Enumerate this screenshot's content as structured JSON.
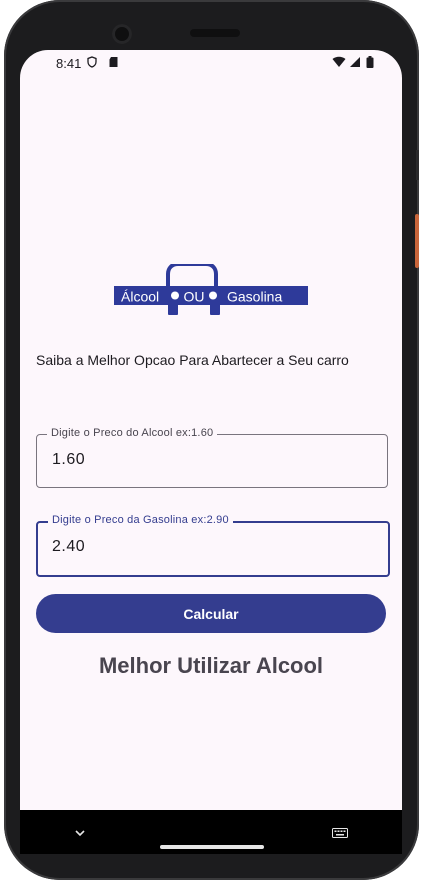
{
  "status_bar": {
    "time": "8:41"
  },
  "logo": {
    "left_text": "Álcool",
    "middle_text": "OU",
    "right_text": "Gasolina",
    "brand_color": "#2e3a9a"
  },
  "subtitle": "Saiba a Melhor Opcao Para Abartecer a Seu carro",
  "alcool_field": {
    "label": "Digite o Preco do Alcool ex:1.60",
    "value": "1.60"
  },
  "gasolina_field": {
    "label": "Digite o Preco da Gasolina ex:2.90",
    "value": "2.40"
  },
  "calcular_button": {
    "label": "Calcular",
    "color": "#343d8f"
  },
  "result_text": "Melhor Utilizar Alcool",
  "nav_bar": {
    "back_icon": "chevron-down-icon",
    "keyboard_icon": "keyboard-icon"
  }
}
